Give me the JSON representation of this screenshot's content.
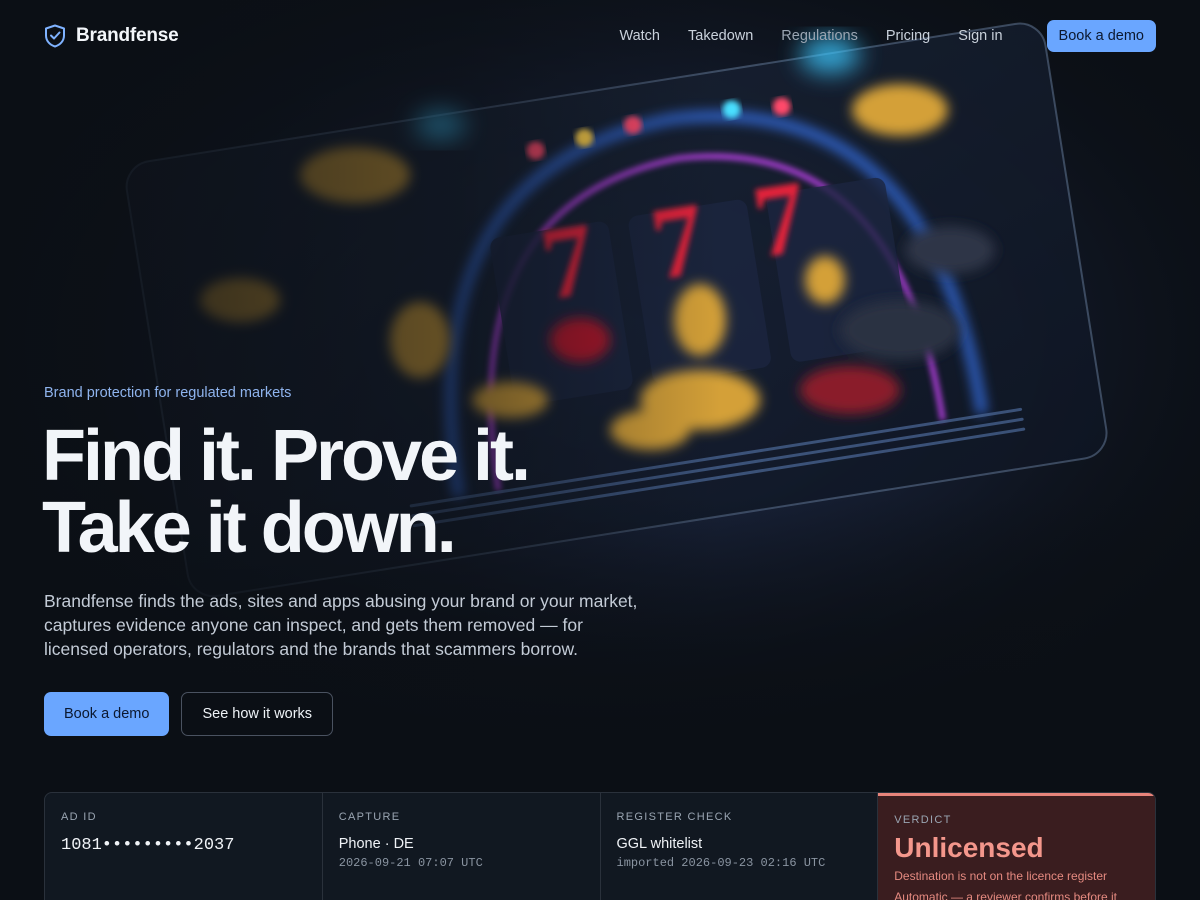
{
  "nav": {
    "brand": "Brandfense",
    "links": [
      "Watch",
      "Takedown",
      "Regulations",
      "Pricing"
    ],
    "sign_in": "Sign in",
    "cta": "Book a demo"
  },
  "hero": {
    "eyebrow": "Brand protection for regulated markets",
    "headline_line1": "Find it. Prove it.",
    "headline_line2": "Take it down.",
    "lede": "Brandfense finds the ads, sites and apps abusing your brand or your market, captures evidence anyone can inspect, and gets them removed — for licensed operators, regulators and the brands that scammers borrow.",
    "primary_cta": "Book a demo",
    "secondary_cta": "See how it works",
    "art_reels": [
      "7",
      "7",
      "7"
    ]
  },
  "evidence": {
    "ad_id": {
      "label": "AD ID",
      "value": "1081•••••••••2037"
    },
    "capture": {
      "label": "CAPTURE",
      "value": "Phone · DE",
      "sub": "2026-09-21 07:07 UTC"
    },
    "register": {
      "label": "REGISTER CHECK",
      "value": "GGL whitelist",
      "sub": "imported 2026-09-23 02:16 UTC"
    },
    "verdict": {
      "label": "VERDICT",
      "value": "Unlicensed",
      "line1": "Destination is not on the licence register",
      "line2": "Automatic — a reviewer confirms before it"
    }
  },
  "colors": {
    "accent": "#6aa6ff",
    "background": "#0b0f15",
    "verdict": "#f4978c"
  },
  "icons": {
    "brand": "shield-check-icon"
  }
}
